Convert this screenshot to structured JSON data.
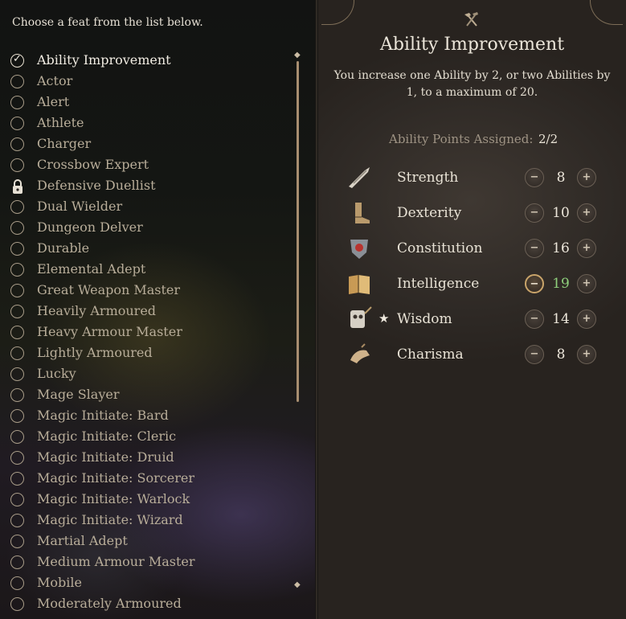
{
  "instruction": "Choose a feat from the list below.",
  "feats": [
    {
      "label": "Ability Improvement",
      "state": "selected"
    },
    {
      "label": "Actor",
      "state": "available"
    },
    {
      "label": "Alert",
      "state": "available"
    },
    {
      "label": "Athlete",
      "state": "available"
    },
    {
      "label": "Charger",
      "state": "available"
    },
    {
      "label": "Crossbow Expert",
      "state": "available"
    },
    {
      "label": "Defensive Duellist",
      "state": "locked"
    },
    {
      "label": "Dual Wielder",
      "state": "available"
    },
    {
      "label": "Dungeon Delver",
      "state": "available"
    },
    {
      "label": "Durable",
      "state": "available"
    },
    {
      "label": "Elemental Adept",
      "state": "available"
    },
    {
      "label": "Great Weapon Master",
      "state": "available"
    },
    {
      "label": "Heavily Armoured",
      "state": "available"
    },
    {
      "label": "Heavy Armour Master",
      "state": "available"
    },
    {
      "label": "Lightly Armoured",
      "state": "available"
    },
    {
      "label": "Lucky",
      "state": "available"
    },
    {
      "label": "Mage Slayer",
      "state": "available"
    },
    {
      "label": "Magic Initiate: Bard",
      "state": "available"
    },
    {
      "label": "Magic Initiate: Cleric",
      "state": "available"
    },
    {
      "label": "Magic Initiate: Druid",
      "state": "available"
    },
    {
      "label": "Magic Initiate: Sorcerer",
      "state": "available"
    },
    {
      "label": "Magic Initiate: Warlock",
      "state": "available"
    },
    {
      "label": "Magic Initiate: Wizard",
      "state": "available"
    },
    {
      "label": "Martial Adept",
      "state": "available"
    },
    {
      "label": "Medium Armour Master",
      "state": "available"
    },
    {
      "label": "Mobile",
      "state": "available"
    },
    {
      "label": "Moderately Armoured",
      "state": "available"
    }
  ],
  "detail": {
    "title": "Ability Improvement",
    "description": "You increase one Ability by 2, or two Abilities by 1, to a maximum of 20.",
    "points_label": "Ability Points Assigned:",
    "points_value": "2/2"
  },
  "abilities": [
    {
      "name": "Strength",
      "score": "8",
      "icon": "strength-arm-icon",
      "starred": false,
      "boosted": false
    },
    {
      "name": "Dexterity",
      "score": "10",
      "icon": "dexterity-boot-icon",
      "starred": false,
      "boosted": false
    },
    {
      "name": "Constitution",
      "score": "16",
      "icon": "constitution-heart-icon",
      "starred": false,
      "boosted": false
    },
    {
      "name": "Intelligence",
      "score": "19",
      "icon": "intelligence-book-icon",
      "starred": false,
      "boosted": true
    },
    {
      "name": "Wisdom",
      "score": "14",
      "icon": "wisdom-owl-icon",
      "starred": true,
      "boosted": false
    },
    {
      "name": "Charisma",
      "score": "8",
      "icon": "charisma-hand-icon",
      "starred": false,
      "boosted": false
    }
  ],
  "glyphs": {
    "check": "✓",
    "star": "★",
    "minus": "−",
    "plus": "+",
    "scroll_up": "◆",
    "scroll_down": "◆"
  },
  "colors": {
    "boosted_score": "#8fd07c",
    "accent_border": "#c9a46a"
  }
}
